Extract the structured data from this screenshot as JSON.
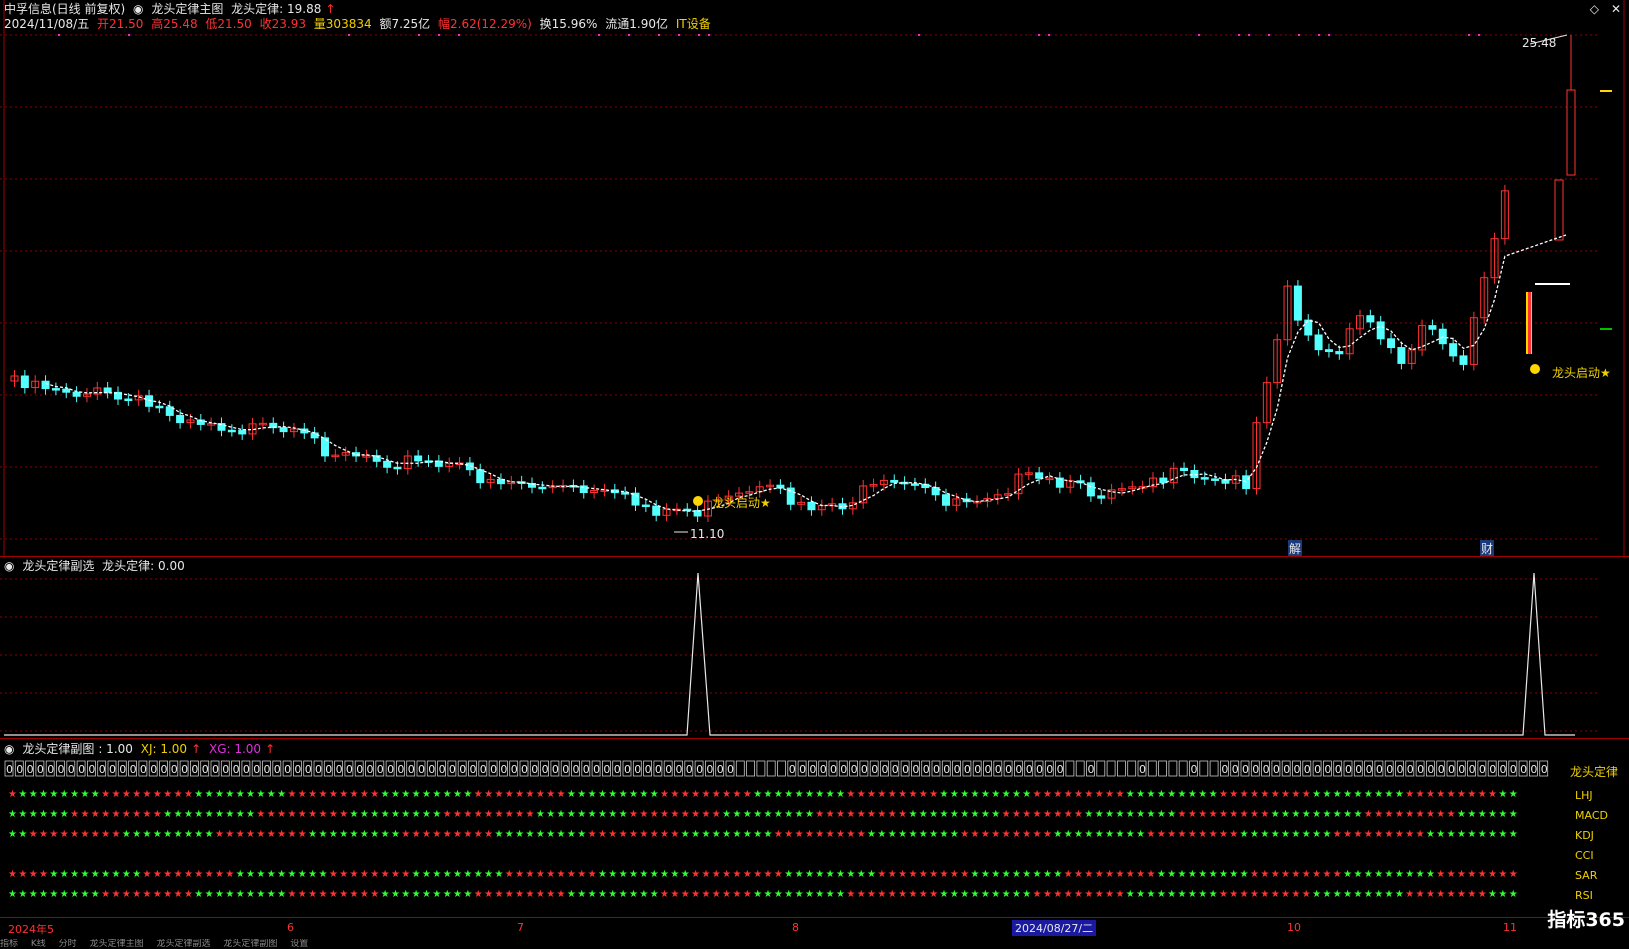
{
  "header1": {
    "stock_name": "中孚信息(日线 前复权)",
    "indicator_title": "龙头定律主图",
    "indicator_label": "龙头定律: 19.88",
    "arrow": "↑"
  },
  "header2": {
    "date": "2024/11/08/五",
    "open": "开21.50",
    "high": "高25.48",
    "low": "低21.50",
    "close": "收23.93",
    "volume": "量303834",
    "amount": "额7.25亿",
    "change": "幅2.62(12.29%)",
    "turnover": "换15.96%",
    "float": "流通1.90亿",
    "sector": "IT设备"
  },
  "main_chart": {
    "high_label": "25.48",
    "low_label": "11.10",
    "signal_text": "龙头启动★",
    "event_jie": "解",
    "event_cai": "财"
  },
  "sub1": {
    "title": "龙头定律副选",
    "value_label": "龙头定律: 0.00"
  },
  "sub2": {
    "title": "龙头定律副图",
    "value_label": ": 1.00",
    "xj_label": "XJ: 1.00",
    "xg_label": "XG: 1.00",
    "arrow": "↑",
    "right_label": "龙头定律",
    "row_labels": [
      "LHJ",
      "MACD",
      "KDJ",
      "CCI",
      "SAR",
      "RSI"
    ]
  },
  "x_axis": {
    "labels": [
      "2024年5",
      "6",
      "7",
      "8",
      "10",
      "11"
    ],
    "cursor_date": "2024/08/27/二"
  },
  "bottom_tabs": [
    "指标",
    "K线",
    "分时",
    "龙头定律主图",
    "龙头定律副选",
    "龙头定律副图",
    "设置"
  ],
  "logo": "指标365",
  "colors": {
    "up": "#ff3232",
    "down": "#54ffff",
    "ma": "#ffffff",
    "grid": "#8b0000",
    "signal": "#ffd700",
    "magenta": "#e030e0"
  }
}
